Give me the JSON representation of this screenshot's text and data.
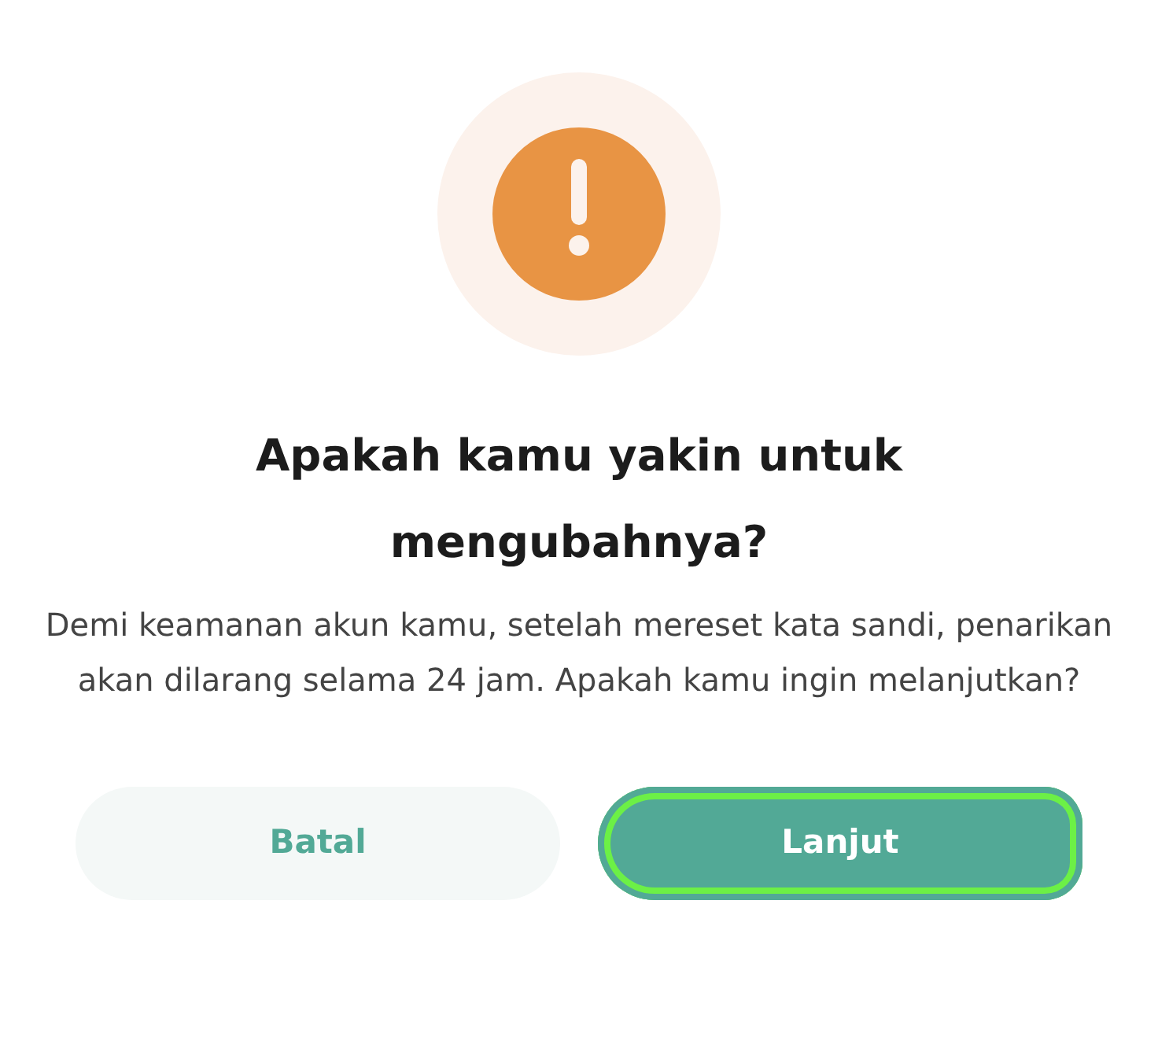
{
  "dialog": {
    "title": "Apakah kamu yakin untuk mengubahnya?",
    "message": "Demi keamanan akun kamu, setelah mereset kata sandi, penarikan akan dilarang selama 24 jam. Apakah kamu ingin melanjutkan?",
    "buttons": [
      {
        "label": "Batal",
        "kind": "secondary",
        "focused": false
      },
      {
        "label": "Lanjut",
        "kind": "primary",
        "focused": true
      }
    ]
  }
}
